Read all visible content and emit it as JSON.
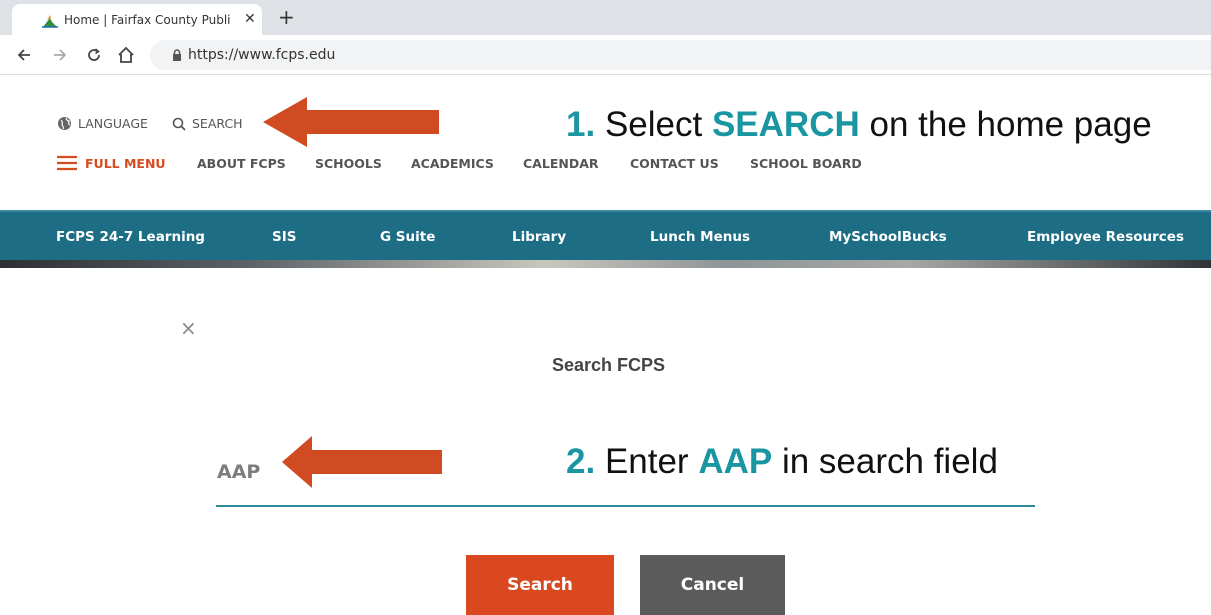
{
  "browser": {
    "tab_title": "Home | Fairfax County Public Schools",
    "tab_close": "✕",
    "new_tab": "+",
    "url": "https://www.fcps.edu"
  },
  "site_header": {
    "language_label": "LANGUAGE",
    "search_label": "SEARCH",
    "full_menu_label": "FULL MENU",
    "nav_items": [
      "ABOUT FCPS",
      "SCHOOLS",
      "ACADEMICS",
      "CALENDAR",
      "CONTACT US",
      "SCHOOL BOARD"
    ]
  },
  "quick_links": [
    "FCPS 24-7 Learning",
    "SIS",
    "G Suite",
    "Library",
    "Lunch Menus",
    "MySchoolBucks",
    "Employee Resources"
  ],
  "instructions": {
    "step1": {
      "number": "1.",
      "before": "Select",
      "keyword": "SEARCH",
      "after": "on the home page"
    },
    "step2": {
      "number": "2.",
      "before": "Enter",
      "keyword": "AAP",
      "after": "in search field"
    }
  },
  "search_dialog": {
    "close": "×",
    "title": "Search FCPS",
    "input_value": "AAP",
    "search_button": "Search",
    "cancel_button": "Cancel"
  },
  "colors": {
    "brand_orange": "#d9481f",
    "brand_teal": "#1d6d84",
    "instruction_teal": "#1a95a2",
    "cancel_gray": "#5b5b5b"
  },
  "icons": {
    "language": "globe-icon",
    "search": "magnifier-icon",
    "menu": "hamburger-icon",
    "lock": "lock-icon"
  }
}
